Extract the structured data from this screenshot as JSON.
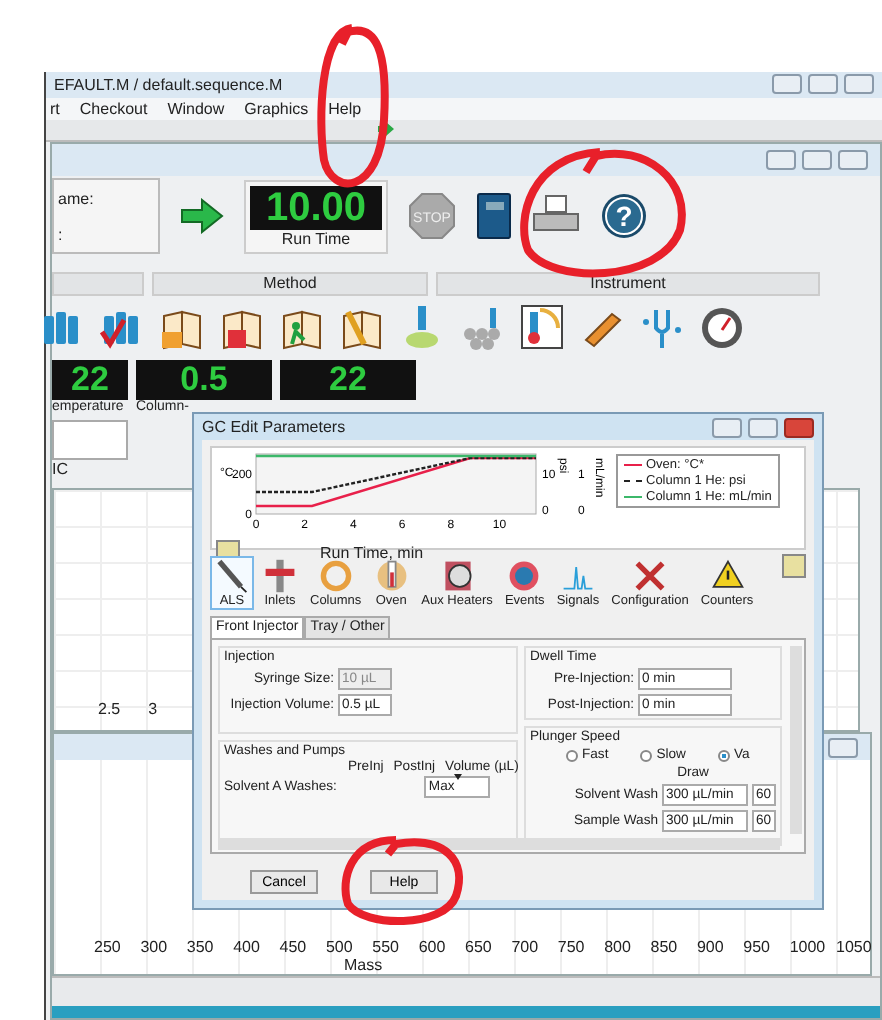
{
  "window": {
    "title": "EFAULT.M / default.sequence.M"
  },
  "menu": [
    "rt",
    "Checkout",
    "Window",
    "Graphics",
    "Help"
  ],
  "run_panel": {
    "name_label": "ame:",
    "second_label": ":",
    "run_time": "10.00",
    "run_time_label": "Run Time",
    "stop": "STOP",
    "help": "?"
  },
  "sections": [
    "Method",
    "Instrument"
  ],
  "readouts": [
    {
      "value": "22",
      "label": "emperature"
    },
    {
      "value": "0.5",
      "label": "Column-"
    },
    {
      "value": "22"
    }
  ],
  "signal_label": "IC",
  "upper_plot": {
    "ticks": [
      "2.5",
      "3"
    ]
  },
  "lower_plot": {
    "ticks": [
      "250",
      "300",
      "350",
      "400",
      "450",
      "500",
      "550",
      "600",
      "650",
      "700",
      "750",
      "800",
      "850",
      "900",
      "950",
      "1000",
      "1050"
    ],
    "xlabel": "Mass"
  },
  "dialog": {
    "title": "GC Edit Parameters",
    "chart_data": {
      "type": "line",
      "xlabel": "Run Time, min",
      "ylabel": "°C",
      "x": [
        0,
        2.3,
        8.8,
        11.5
      ],
      "xlim": [
        0,
        11.5
      ],
      "ylim": [
        0,
        300
      ],
      "xticks": [
        0,
        2,
        4,
        6,
        8,
        10
      ],
      "yticks": [
        0,
        200
      ],
      "series": [
        {
          "name": "Oven: °C*",
          "color": "#e8204a",
          "values": [
            40,
            40,
            280,
            280
          ],
          "line_style": "solid"
        },
        {
          "name": "Column 1 He: psi",
          "color": "#222222",
          "values": [
            110,
            110,
            280,
            280
          ],
          "line_style": "dashed"
        },
        {
          "name": "Column 1 He: mL/min",
          "color": "#3cb86a",
          "values": [
            290,
            290,
            290,
            290
          ],
          "line_style": "solid"
        }
      ]
    },
    "right_axes": [
      {
        "label": "psi",
        "ticks": [
          "10",
          "0"
        ]
      },
      {
        "label": "mL/min",
        "ticks": [
          "1",
          "0"
        ]
      }
    ],
    "categories": [
      {
        "label": "ALS",
        "selected": true
      },
      {
        "label": "Inlets",
        "selected": false
      },
      {
        "label": "Columns",
        "selected": false
      },
      {
        "label": "Oven",
        "selected": false
      },
      {
        "label": "Aux Heaters",
        "selected": false
      },
      {
        "label": "Events",
        "selected": false
      },
      {
        "label": "Signals",
        "selected": false
      },
      {
        "label": "Configuration",
        "selected": false
      },
      {
        "label": "Counters",
        "selected": false
      }
    ],
    "tabs": [
      {
        "label": "Front Injector",
        "selected": true
      },
      {
        "label": "Tray / Other",
        "selected": false
      }
    ],
    "injection": {
      "title": "Injection",
      "fields": [
        {
          "label": "Syringe Size:",
          "value": "10 µL",
          "disabled": true
        },
        {
          "label": "Injection Volume:",
          "value": "0.5 µL",
          "disabled": false
        }
      ]
    },
    "washes": {
      "title": "Washes and Pumps",
      "columns": [
        "PreInj",
        "PostInj",
        "Volume (µL)"
      ],
      "row_label": "Solvent A Washes:",
      "volume": "Max"
    },
    "dwell": {
      "title": "Dwell Time",
      "fields": [
        {
          "label": "Pre-Injection:",
          "value": "0 min"
        },
        {
          "label": "Post-Injection:",
          "value": "0 min"
        }
      ]
    },
    "plunger": {
      "title": "Plunger Speed",
      "options": [
        {
          "label": "Fast",
          "selected": false
        },
        {
          "label": "Slow",
          "selected": false
        },
        {
          "label": "Va",
          "selected": true
        }
      ]
    },
    "draw": {
      "title": "Draw",
      "rows": [
        {
          "label": "Solvent Wash",
          "value": "300 µL/min",
          "extra": "60"
        },
        {
          "label": "Sample Wash",
          "value": "300 µL/min",
          "extra": "60"
        }
      ]
    },
    "buttons": [
      "Cancel",
      "Help"
    ]
  }
}
